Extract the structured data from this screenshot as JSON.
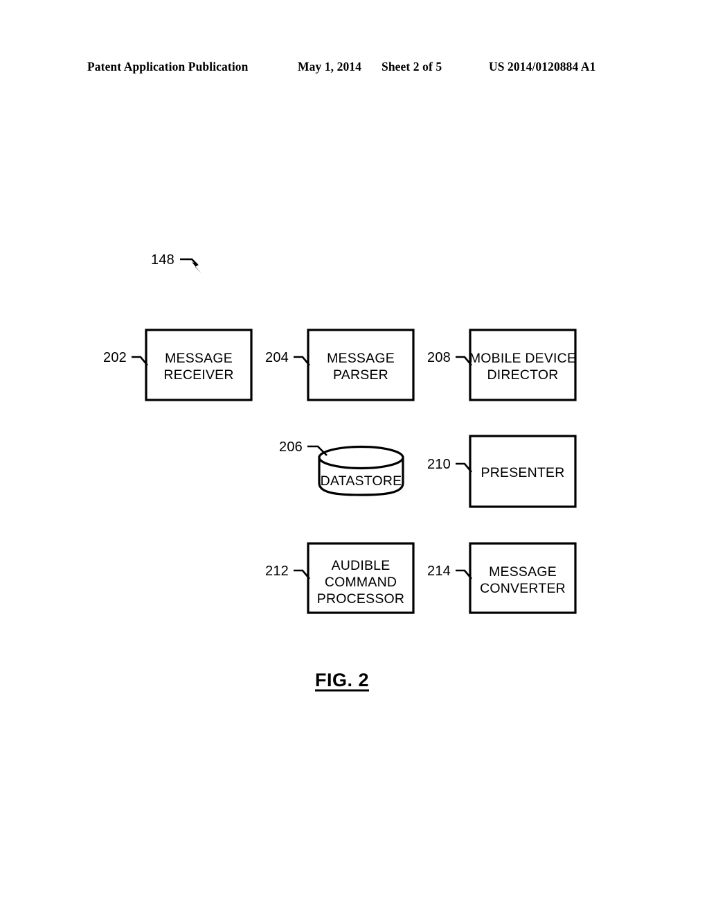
{
  "header": {
    "publication": "Patent Application Publication",
    "date": "May 1, 2014",
    "sheet": "Sheet 2 of 5",
    "patent_number": "US 2014/0120884 A1"
  },
  "figure": {
    "caption": "FIG. 2",
    "system_ref": "148",
    "components": [
      {
        "ref": "202",
        "lines": [
          "MESSAGE",
          "RECEIVER"
        ],
        "shape": "rectangle"
      },
      {
        "ref": "204",
        "lines": [
          "MESSAGE",
          "PARSER"
        ],
        "shape": "rectangle"
      },
      {
        "ref": "208",
        "lines": [
          "MOBILE DEVICE",
          "DIRECTOR"
        ],
        "shape": "rectangle"
      },
      {
        "ref": "206",
        "lines": [
          "DATASTORE"
        ],
        "shape": "cylinder"
      },
      {
        "ref": "210",
        "lines": [
          "PRESENTER"
        ],
        "shape": "rectangle"
      },
      {
        "ref": "212",
        "lines": [
          "AUDIBLE",
          "COMMAND",
          "PROCESSOR"
        ],
        "shape": "rectangle"
      },
      {
        "ref": "214",
        "lines": [
          "MESSAGE",
          "CONVERTER"
        ],
        "shape": "rectangle"
      }
    ]
  },
  "colors": {
    "ink": "#000000",
    "paper": "#ffffff"
  }
}
